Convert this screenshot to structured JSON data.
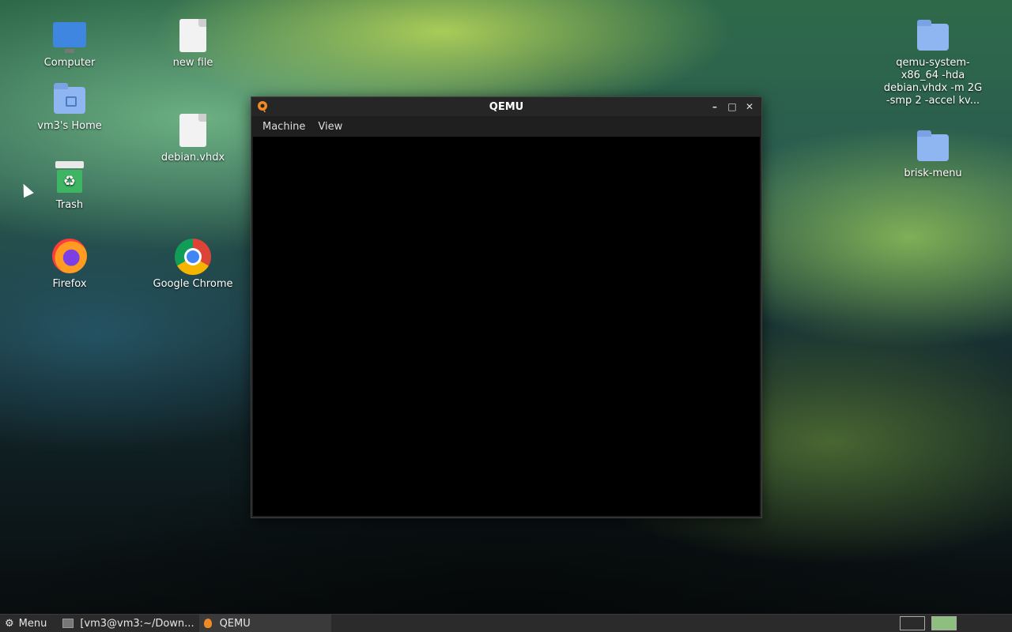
{
  "desktop": {
    "icons": {
      "computer": "Computer",
      "home": "vm3's Home",
      "trash": "Trash",
      "firefox": "Firefox",
      "new_file": "new file",
      "debian": "debian.vhdx",
      "chrome": "Google Chrome",
      "qemu_folder": "qemu-system-x86_64 -hda debian.vhdx -m 2G -smp 2 -accel kv...",
      "brisk": "brisk-menu"
    }
  },
  "window": {
    "title": "QEMU",
    "menus": [
      "Machine",
      "View"
    ],
    "buttons": {
      "minimize": "–",
      "maximize": "□",
      "close": "✕"
    }
  },
  "taskbar": {
    "menu_label": "Menu",
    "tasks": [
      "[vm3@vm3:~/Down...",
      "QEMU"
    ]
  },
  "colors": {
    "window_bg": "#1f1f1f",
    "vm_screen": "#000000",
    "taskbar": "#2b2b2b"
  }
}
